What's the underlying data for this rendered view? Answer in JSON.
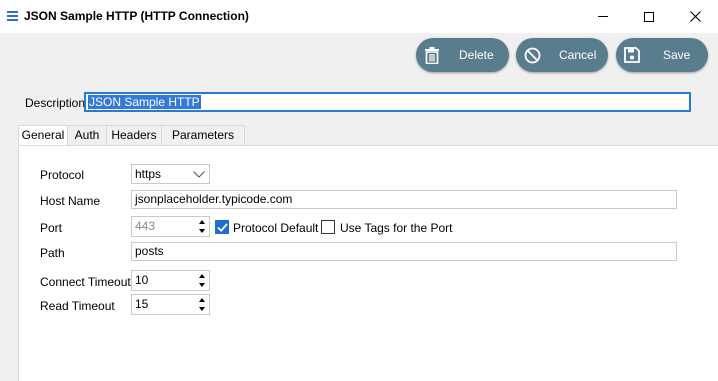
{
  "window": {
    "title": "JSON Sample HTTP (HTTP Connection)",
    "icon": "list-icon",
    "controls": {
      "minimize": "minimize-icon",
      "maximize": "maximize-icon",
      "close": "close-icon"
    }
  },
  "toolbar": {
    "delete_label": "Delete",
    "cancel_label": "Cancel",
    "save_label": "Save",
    "button_color": "#5a7d8e"
  },
  "description": {
    "label": "Description",
    "value": "JSON Sample HTTP"
  },
  "tabs": [
    {
      "label": "General",
      "active": true
    },
    {
      "label": "Auth",
      "active": false
    },
    {
      "label": "Headers",
      "active": false
    },
    {
      "label": "Parameters",
      "active": false
    }
  ],
  "general": {
    "protocol": {
      "label": "Protocol",
      "value": "https"
    },
    "host": {
      "label": "Host Name",
      "value": "jsonplaceholder.typicode.com"
    },
    "port": {
      "label": "Port",
      "value": "443",
      "protocol_default_label": "Protocol Default",
      "protocol_default_checked": true,
      "use_tags_label": "Use Tags for the Port",
      "use_tags_checked": false
    },
    "path": {
      "label": "Path",
      "value": "posts"
    },
    "connect_timeout": {
      "label": "Connect Timeout",
      "value": "10"
    },
    "read_timeout": {
      "label": "Read Timeout",
      "value": "15"
    }
  }
}
